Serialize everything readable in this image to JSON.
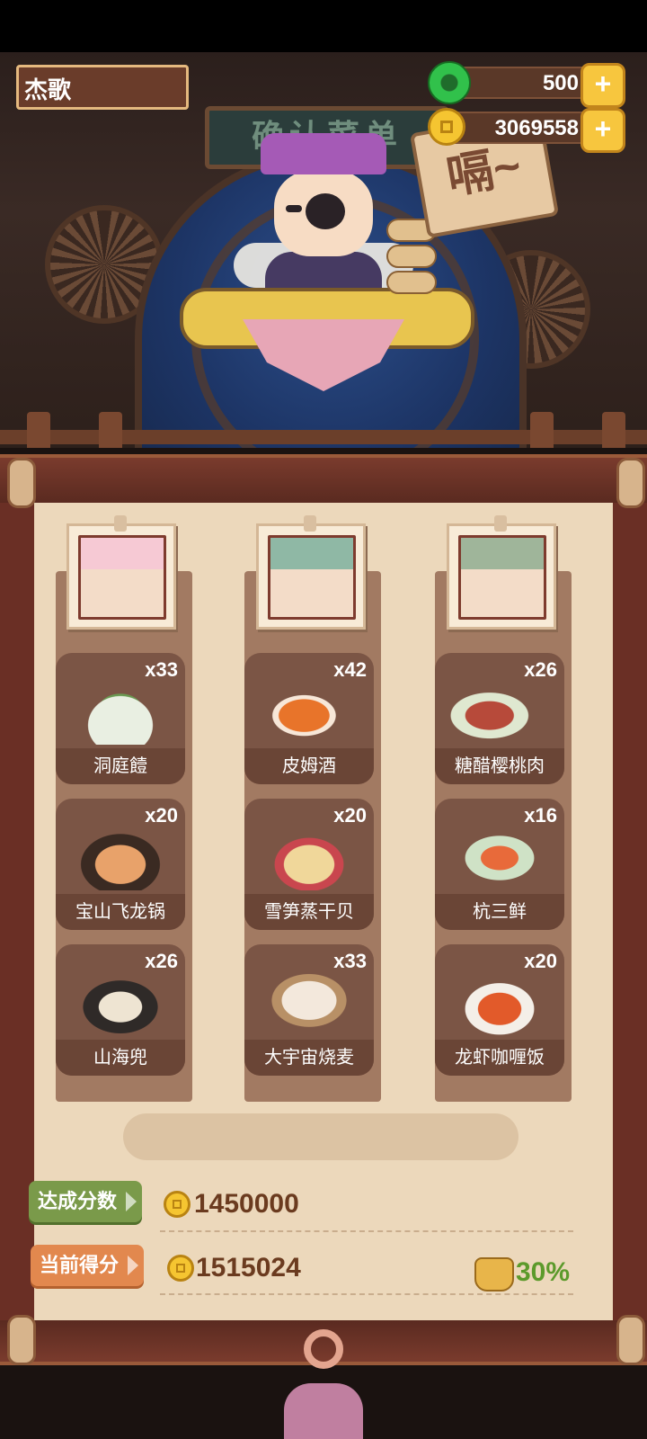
{
  "player": {
    "name": "杰歌"
  },
  "currency": {
    "jade": "500",
    "coins": "3069558"
  },
  "scene": {
    "sign_text": "确认菜单",
    "speech_sign": "嗝~"
  },
  "columns": [
    {
      "dishes": [
        {
          "name": "洞庭饐",
          "count": "x33"
        },
        {
          "name": "宝山飞龙锅",
          "count": "x20"
        },
        {
          "name": "山海兜",
          "count": "x26"
        }
      ]
    },
    {
      "dishes": [
        {
          "name": "皮姆酒",
          "count": "x42"
        },
        {
          "name": "雪笋蒸干贝",
          "count": "x20"
        },
        {
          "name": "大宇宙烧麦",
          "count": "x33"
        }
      ]
    },
    {
      "dishes": [
        {
          "name": "糖醋樱桃肉",
          "count": "x26"
        },
        {
          "name": "杭三鲜",
          "count": "x16"
        },
        {
          "name": "龙虾咖喱饭",
          "count": "x20"
        }
      ]
    }
  ],
  "score": {
    "target_label": "达成分数",
    "target_value": "1450000",
    "current_label": "当前得分",
    "current_value": "1515024",
    "bonus_percent": "30%"
  },
  "colors": {
    "target_tag": "#7a9a4a",
    "current_tag": "#e2884e",
    "accent_green": "#5c9a2b"
  }
}
